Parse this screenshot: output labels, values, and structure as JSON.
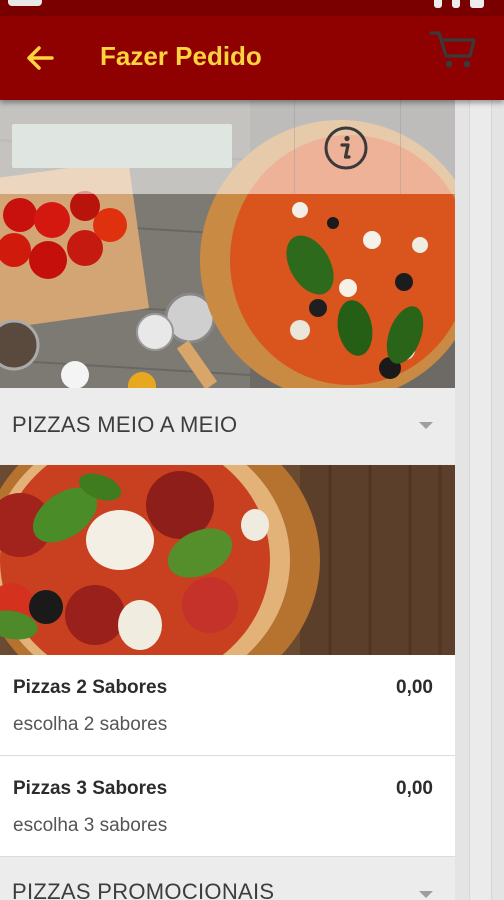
{
  "header": {
    "title": "Fazer Pedido",
    "back_icon": "arrow-left-icon",
    "accent_color": "#8f0000",
    "title_color": "#ffd23f"
  },
  "toolbar": {
    "search_placeholder": "",
    "info_icon": "info-icon",
    "cart_icon": "cart-icon"
  },
  "sections": [
    {
      "title": "PIZZAS MEIO A MEIO",
      "items": [
        {
          "name": "Pizzas 2 Sabores",
          "price": "0,00",
          "description": "escolha 2 sabores"
        },
        {
          "name": "Pizzas 3 Sabores",
          "price": "0,00",
          "description": "escolha 3 sabores"
        }
      ]
    },
    {
      "title": "PIZZAS PROMOCIONAIS",
      "items": []
    }
  ]
}
